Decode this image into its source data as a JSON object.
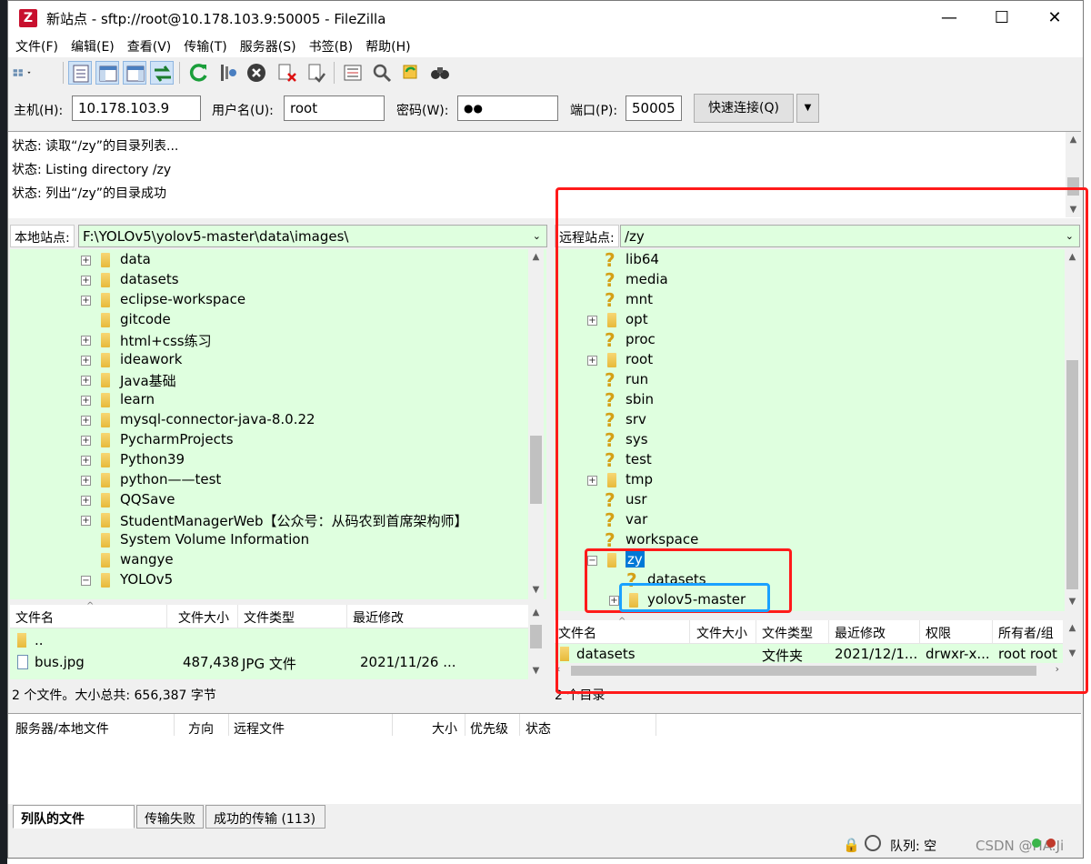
{
  "window": {
    "title": "新站点 - sftp://root@10.178.103.9:50005 - FileZilla",
    "icon": "filezilla-icon",
    "minimize": "—",
    "maximize": "☐",
    "close": "✕"
  },
  "menu": [
    "文件(F)",
    "编辑(E)",
    "查看(V)",
    "传输(T)",
    "服务器(S)",
    "书签(B)",
    "帮助(H)"
  ],
  "quickconnect": {
    "host_label": "主机(H):",
    "host_value": "10.178.103.9",
    "user_label": "用户名(U):",
    "user_value": "root",
    "pass_label": "密码(W):",
    "pass_value": "●●",
    "port_label": "端口(P):",
    "port_value": "50005",
    "connect_button": "快速连接(Q)",
    "dropdown": "▼"
  },
  "log": [
    "状态:  读取“/zy”的目录列表...",
    "状态:  Listing directory /zy",
    "状态:  列出“/zy”的目录成功"
  ],
  "local": {
    "site_label": "本地站点:",
    "path": "F:\\YOLOv5\\yolov5-master\\data\\images\\",
    "tree": [
      {
        "name": "data",
        "expand": "+"
      },
      {
        "name": "datasets",
        "expand": "+"
      },
      {
        "name": "eclipse-workspace",
        "expand": "+"
      },
      {
        "name": "gitcode",
        "expand": ""
      },
      {
        "name": "html+css练习",
        "expand": "+"
      },
      {
        "name": "ideawork",
        "expand": "+"
      },
      {
        "name": "Java基础",
        "expand": "+"
      },
      {
        "name": "learn",
        "expand": "+"
      },
      {
        "name": "mysql-connector-java-8.0.22",
        "expand": "+"
      },
      {
        "name": "PycharmProjects",
        "expand": "+"
      },
      {
        "name": "Python39",
        "expand": "+"
      },
      {
        "name": "python——test",
        "expand": "+"
      },
      {
        "name": "QQSave",
        "expand": "+"
      },
      {
        "name": "StudentManagerWeb【公众号：从码农到首席架构师】",
        "expand": "+"
      },
      {
        "name": "System Volume Information",
        "expand": ""
      },
      {
        "name": "wangye",
        "expand": ""
      },
      {
        "name": "YOLOv5",
        "expand": "−"
      }
    ],
    "columns": [
      "文件名",
      "文件大小",
      "文件类型",
      "最近修改"
    ],
    "files": [
      {
        "name": "..",
        "size": "",
        "type": "",
        "modified": ""
      },
      {
        "name": "bus.jpg",
        "size": "487,438",
        "type": "JPG 文件",
        "modified": "2021/11/26 ..."
      }
    ],
    "status": "2 个文件。大小总共: 656,387 字节"
  },
  "remote": {
    "site_label": "远程站点:",
    "path": "/zy",
    "tree": [
      {
        "name": "lib64",
        "kind": "q",
        "expand": ""
      },
      {
        "name": "media",
        "kind": "q",
        "expand": ""
      },
      {
        "name": "mnt",
        "kind": "q",
        "expand": ""
      },
      {
        "name": "opt",
        "kind": "f",
        "expand": "+"
      },
      {
        "name": "proc",
        "kind": "q",
        "expand": ""
      },
      {
        "name": "root",
        "kind": "f",
        "expand": "+"
      },
      {
        "name": "run",
        "kind": "q",
        "expand": ""
      },
      {
        "name": "sbin",
        "kind": "q",
        "expand": ""
      },
      {
        "name": "srv",
        "kind": "q",
        "expand": ""
      },
      {
        "name": "sys",
        "kind": "q",
        "expand": ""
      },
      {
        "name": "test",
        "kind": "q",
        "expand": ""
      },
      {
        "name": "tmp",
        "kind": "f",
        "expand": "+"
      },
      {
        "name": "usr",
        "kind": "q",
        "expand": ""
      },
      {
        "name": "var",
        "kind": "q",
        "expand": ""
      },
      {
        "name": "workspace",
        "kind": "q",
        "expand": ""
      },
      {
        "name": "zy",
        "kind": "f",
        "expand": "−"
      },
      {
        "name": "datasets",
        "kind": "q",
        "expand": ""
      },
      {
        "name": "yolov5-master",
        "kind": "f",
        "expand": "+"
      }
    ],
    "columns": [
      "文件名",
      "文件大小",
      "文件类型",
      "最近修改",
      "权限",
      "所有者/组"
    ],
    "files": [
      {
        "name": "datasets",
        "size": "",
        "type": "文件夹",
        "modified": "2021/12/1...",
        "perm": "drwxr-x...",
        "owner": "root root"
      }
    ],
    "status": "2 个目录"
  },
  "queue": {
    "columns": [
      "服务器/本地文件",
      "方向",
      "远程文件",
      "大小",
      "优先级",
      "状态"
    ],
    "tabs": [
      "列队的文件",
      "传输失败",
      "成功的传输 (113)"
    ]
  },
  "statusbar": {
    "queue": "队列: 空",
    "watermark": "CSDN @HA.Ji"
  },
  "colors": {
    "highlight_red": "#ff1a1a",
    "highlight_blue": "#1aa1ff",
    "pane_bg": "#dfffdf",
    "selection": "#0078d7"
  }
}
